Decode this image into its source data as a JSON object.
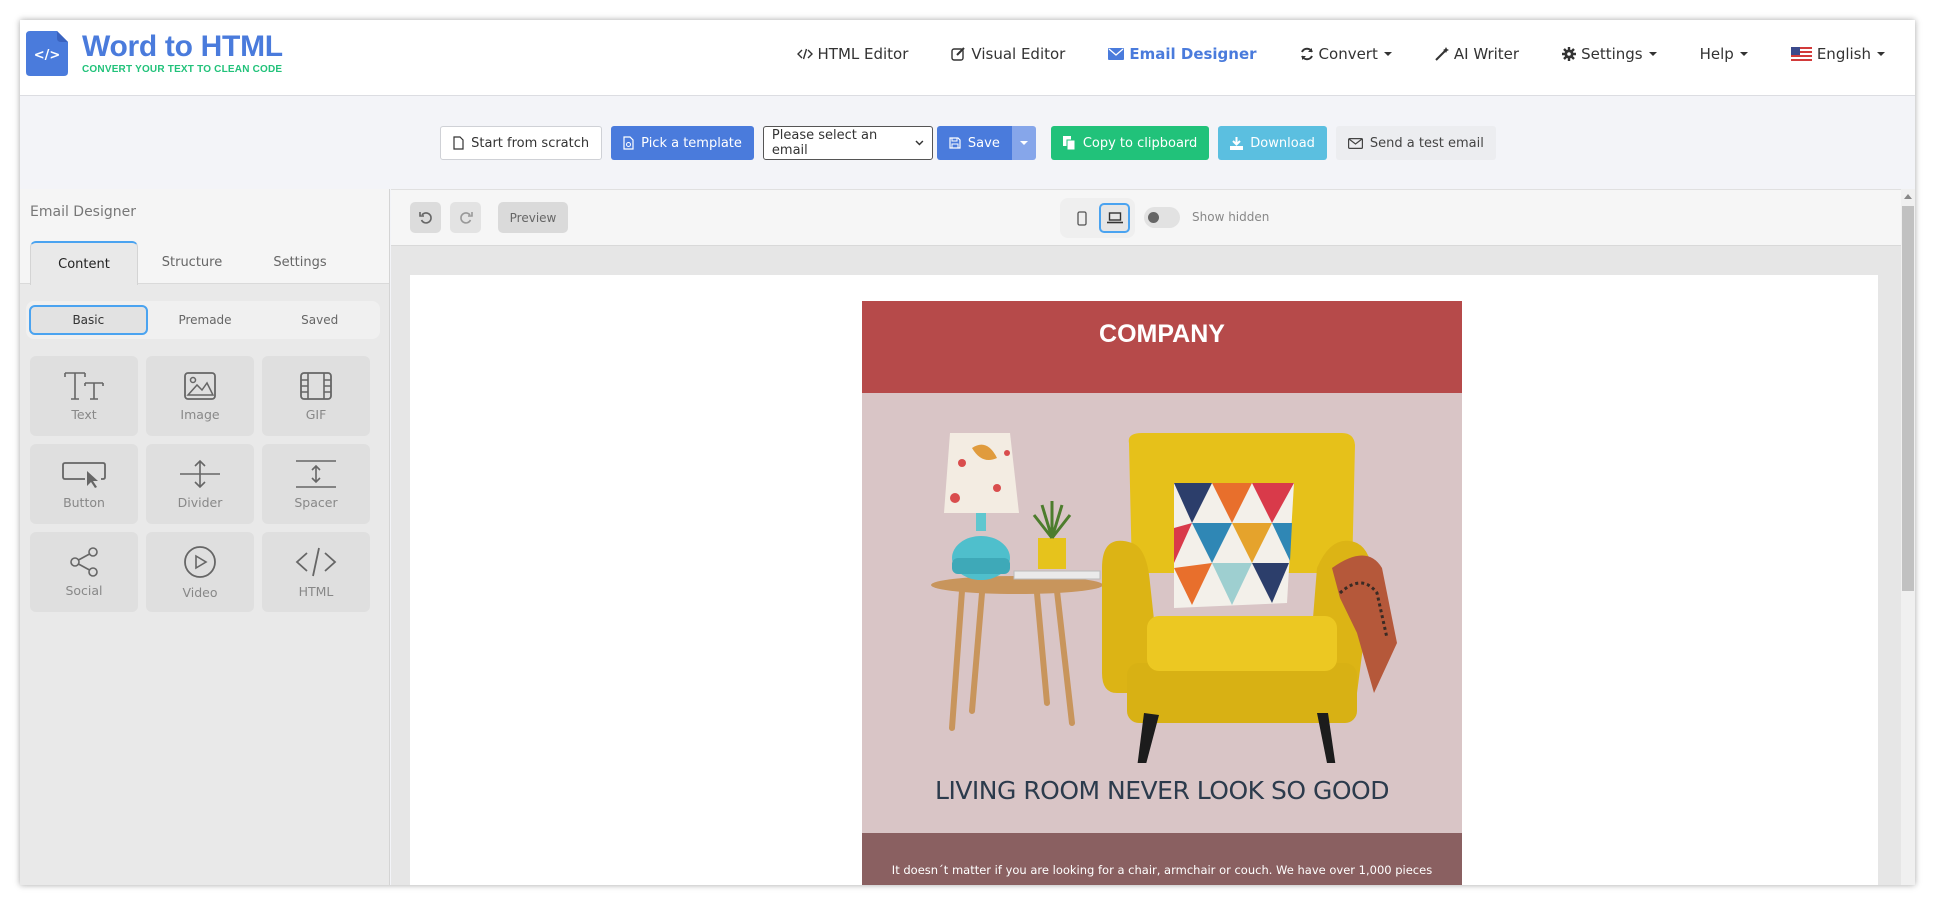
{
  "app": {
    "title": "Word to HTML",
    "tagline": "CONVERT YOUR TEXT TO CLEAN CODE",
    "brand_color": "#4a7bdc",
    "tagline_color": "#21c27a"
  },
  "nav": {
    "items": [
      {
        "label": "HTML Editor",
        "icon": "code-icon",
        "active": false,
        "dropdown": false
      },
      {
        "label": "Visual Editor",
        "icon": "edit-icon",
        "active": false,
        "dropdown": false
      },
      {
        "label": "Email Designer",
        "icon": "envelope-icon",
        "active": true,
        "dropdown": false
      },
      {
        "label": "Convert",
        "icon": "refresh-icon",
        "active": false,
        "dropdown": true
      },
      {
        "label": "AI Writer",
        "icon": "magic-wand-icon",
        "active": false,
        "dropdown": false
      },
      {
        "label": "Settings",
        "icon": "gear-icon",
        "active": false,
        "dropdown": true
      },
      {
        "label": "Help",
        "icon": "",
        "active": false,
        "dropdown": true
      },
      {
        "label": "English",
        "icon": "us-flag-icon",
        "active": false,
        "dropdown": true
      }
    ]
  },
  "toolbar": {
    "start_from_scratch": "Start from scratch",
    "pick_template": "Pick a template",
    "email_select": {
      "selected": "Please select an email"
    },
    "save": "Save",
    "copy_to_clipboard": "Copy to clipboard",
    "download": "Download",
    "send_test_email": "Send a test email"
  },
  "sidebar": {
    "title": "Email Designer",
    "tabs": [
      {
        "label": "Content",
        "active": true
      },
      {
        "label": "Structure",
        "active": false
      },
      {
        "label": "Settings",
        "active": false
      }
    ],
    "subtabs": [
      {
        "label": "Basic",
        "active": true
      },
      {
        "label": "Premade",
        "active": false
      },
      {
        "label": "Saved",
        "active": false
      }
    ],
    "blocks": [
      {
        "label": "Text",
        "icon": "text-icon"
      },
      {
        "label": "Image",
        "icon": "image-icon"
      },
      {
        "label": "GIF",
        "icon": "film-icon"
      },
      {
        "label": "Button",
        "icon": "button-icon"
      },
      {
        "label": "Divider",
        "icon": "divider-icon"
      },
      {
        "label": "Spacer",
        "icon": "spacer-icon"
      },
      {
        "label": "Social",
        "icon": "share-icon"
      },
      {
        "label": "Video",
        "icon": "play-icon"
      },
      {
        "label": "HTML",
        "icon": "code-icon"
      }
    ]
  },
  "canvas": {
    "preview_label": "Preview",
    "show_hidden_label": "Show hidden",
    "show_hidden": false,
    "device": "desktop"
  },
  "email": {
    "company": "COMPANY",
    "header_color": "#b64a4a",
    "hero_color": "#d9c5c6",
    "body_color": "#8a6061",
    "headline": "LIVING ROOM NEVER LOOK SO GOOD",
    "body_line1": "It doesn´t matter if you are looking for a chair, armchair or couch. We have over 1,000 pieces"
  }
}
